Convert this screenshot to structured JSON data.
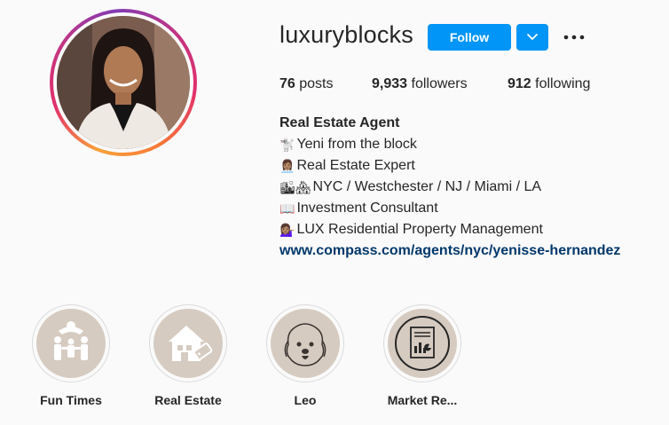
{
  "profile": {
    "username": "luxuryblocks",
    "follow_label": "Follow",
    "stats": {
      "posts_count": "76",
      "posts_label": "posts",
      "followers_count": "9,933",
      "followers_label": "followers",
      "following_count": "912",
      "following_label": "following"
    }
  },
  "bio": {
    "name": "Real Estate Agent",
    "lines": [
      {
        "emoji": "🐩",
        "text": "Yeni from the block"
      },
      {
        "emoji": "👩🏽‍💼",
        "text": "Real Estate Expert"
      },
      {
        "emoji": "🏙🏘",
        "text": "NYC / Westchester / NJ / Miami / LA"
      },
      {
        "emoji": "📖",
        "text": "Investment Consultant"
      },
      {
        "emoji": "💁🏽‍♀️",
        "text": "LUX Residential Property Management"
      }
    ],
    "link": "www.compass.com/agents/nyc/yenisse-hernandez"
  },
  "highlights": [
    {
      "label": "Fun Times",
      "icon": "family-icon"
    },
    {
      "label": "Real Estate",
      "icon": "house-tag-icon"
    },
    {
      "label": "Leo",
      "icon": "dog-icon"
    },
    {
      "label": "Market Re...",
      "icon": "report-icon"
    }
  ],
  "colors": {
    "accent": "#0095f6",
    "link": "#00376b",
    "highlight_bg": "#d6cbc0"
  }
}
